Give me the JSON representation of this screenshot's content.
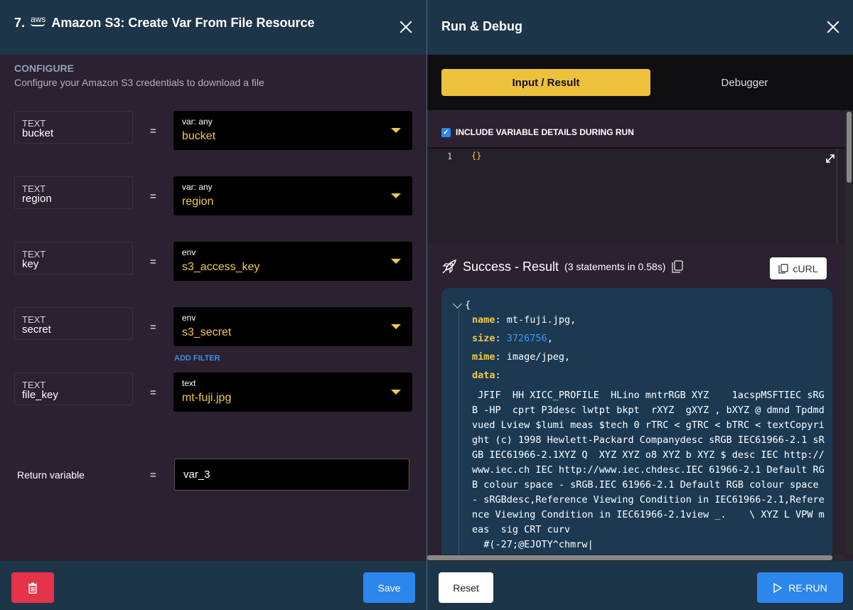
{
  "left_panel": {
    "step_number": "7.",
    "provider_icon": "aws-logo",
    "provider_logo_text": "aws",
    "title": "Amazon S3: Create Var From File Resource",
    "section_label": "CONFIGURE",
    "section_desc": "Configure your Amazon S3 credentials to download a file",
    "params": [
      {
        "type": "TEXT",
        "name": "bucket",
        "value_type": "var: any",
        "value": "bucket"
      },
      {
        "type": "TEXT",
        "name": "region",
        "value_type": "var: any",
        "value": "region"
      },
      {
        "type": "TEXT",
        "name": "key",
        "value_type": "env",
        "value": "s3_access_key"
      },
      {
        "type": "TEXT",
        "name": "secret",
        "value_type": "env",
        "value": "s3_secret"
      },
      {
        "type": "TEXT",
        "name": "file_key",
        "value_type": "text",
        "value": "mt-fuji.jpg"
      }
    ],
    "equals": "=",
    "add_filter_label": "ADD FILTER",
    "return_label": "Return variable",
    "return_value": "var_3",
    "save_label": "Save"
  },
  "right_panel": {
    "title": "Run & Debug",
    "tabs": [
      {
        "label": "Input / Result",
        "active": true
      },
      {
        "label": "Debugger",
        "active": false
      }
    ],
    "include_label": "INCLUDE VARIABLE DETAILS DURING RUN",
    "include_checked": true,
    "editor": {
      "line_number": "1",
      "code": "{}"
    },
    "result_title": "Success - Result",
    "result_meta": "(3 statements in 0.58s)",
    "curl_label": "cURL",
    "json": {
      "open_brace": "{",
      "name_key": "name",
      "name_value": "mt-fuji.jpg,",
      "size_key": "size",
      "size_value": "3726756",
      "size_comma": ",",
      "mime_key": "mime",
      "mime_value": "image/jpeg,",
      "data_key": "data",
      "data_value": " JFIF  HH XICC_PROFILE  HLino mntrRGB XYZ    1acspMSFTIEC sRGB -HP  cprt P3desc lwtpt bkpt  rXYZ  gXYZ , bXYZ @ dmnd Tpdmd vued Lview $lumi meas $tech 0 rTRC < gTRC < bTRC < textCopyright (c) 1998 Hewlett-Packard Companydesc sRGB IEC61966-2.1 sRGB IEC61966-2.1XYZ Q  XYZ XYZ o8 XYZ b XYZ $ desc IEC http://www.iec.ch IEC http://www.iec.chdesc.IEC 61966-2.1 Default RGB colour space - sRGB.IEC 61966-2.1 Default RGB colour space - sRGBdesc,Reference Viewing Condition in IEC61966-2.1,Reference Viewing Condition in IEC61966-2.1view _.    \\ XYZ L VPW meas  sig CRT curv\n  #(-27;@EJOTY^chmrw|"
    },
    "reset_label": "Reset",
    "rerun_label": "RE-RUN"
  },
  "colors": {
    "header_bg": "#1d3549",
    "panel_bg": "#2b2130",
    "accent_yellow": "#edc13c",
    "primary_blue": "#2c86ec",
    "danger_red": "#e5334a"
  }
}
